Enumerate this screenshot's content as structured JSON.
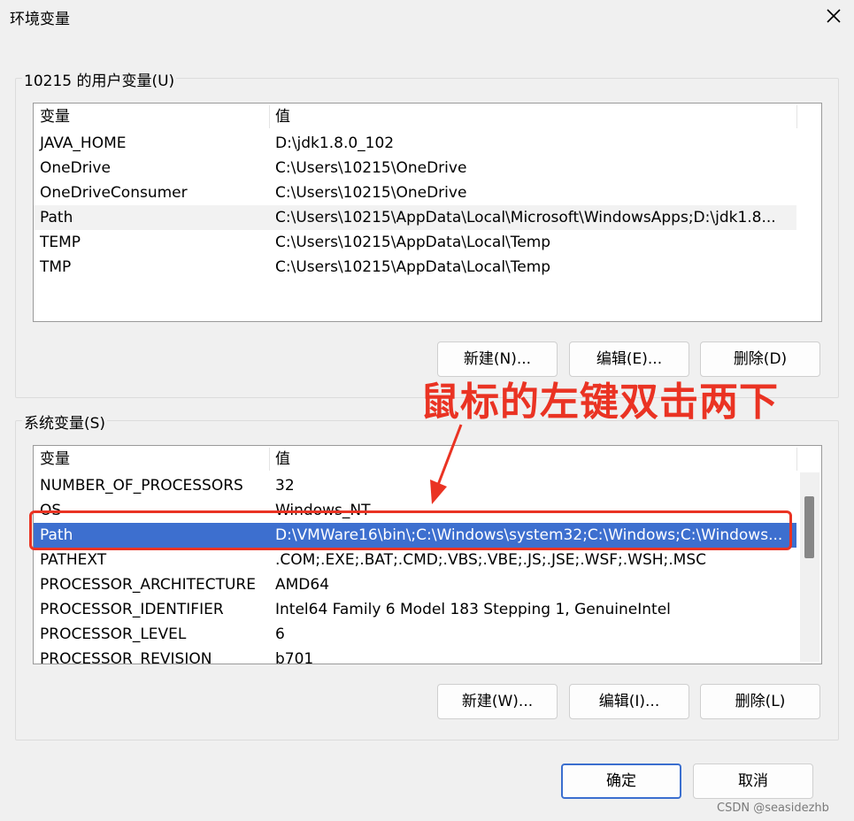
{
  "window": {
    "title": "环境变量"
  },
  "user_vars": {
    "label": "10215 的用户变量(U)",
    "headers": {
      "name": "变量",
      "value": "值"
    },
    "rows": [
      {
        "name": "JAVA_HOME",
        "value": "D:\\jdk1.8.0_102"
      },
      {
        "name": "OneDrive",
        "value": "C:\\Users\\10215\\OneDrive"
      },
      {
        "name": "OneDriveConsumer",
        "value": "C:\\Users\\10215\\OneDrive"
      },
      {
        "name": "Path",
        "value": "C:\\Users\\10215\\AppData\\Local\\Microsoft\\WindowsApps;D:\\jdk1.8..."
      },
      {
        "name": "TEMP",
        "value": "C:\\Users\\10215\\AppData\\Local\\Temp"
      },
      {
        "name": "TMP",
        "value": "C:\\Users\\10215\\AppData\\Local\\Temp"
      }
    ],
    "buttons": {
      "new": "新建(N)...",
      "edit": "编辑(E)...",
      "delete": "删除(D)"
    }
  },
  "system_vars": {
    "label": "系统变量(S)",
    "headers": {
      "name": "变量",
      "value": "值"
    },
    "rows": [
      {
        "name": "NUMBER_OF_PROCESSORS",
        "value": "32"
      },
      {
        "name": "OS",
        "value": "Windows_NT"
      },
      {
        "name": "Path",
        "value": "D:\\VMWare16\\bin\\;C:\\Windows\\system32;C:\\Windows;C:\\Windows..."
      },
      {
        "name": "PATHEXT",
        "value": ".COM;.EXE;.BAT;.CMD;.VBS;.VBE;.JS;.JSE;.WSF;.WSH;.MSC"
      },
      {
        "name": "PROCESSOR_ARCHITECTURE",
        "value": "AMD64"
      },
      {
        "name": "PROCESSOR_IDENTIFIER",
        "value": "Intel64 Family 6 Model 183 Stepping 1, GenuineIntel"
      },
      {
        "name": "PROCESSOR_LEVEL",
        "value": "6"
      },
      {
        "name": "PROCESSOR_REVISION",
        "value": "b701"
      }
    ],
    "selected_row": "Path",
    "buttons": {
      "new": "新建(W)...",
      "edit": "编辑(I)...",
      "delete": "删除(L)"
    }
  },
  "footer": {
    "ok": "确定",
    "cancel": "取消"
  },
  "annotation": {
    "text": "鼠标的左键双击两下",
    "color": "#ea3323"
  },
  "watermark": "CSDN @seasidezhb",
  "colors": {
    "selection": "#3d6fcf",
    "accent": "#3b6fcf"
  }
}
